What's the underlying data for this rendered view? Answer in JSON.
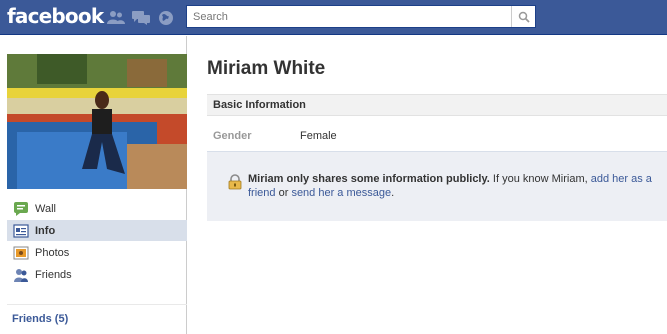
{
  "topbar": {
    "logo": "facebook",
    "jewels": [
      "friend-requests-icon",
      "messages-icon",
      "notifications-icon"
    ],
    "search_placeholder": "Search"
  },
  "profile": {
    "name": "Miriam White"
  },
  "nav": {
    "items": [
      {
        "label": "Wall",
        "icon": "wall-icon"
      },
      {
        "label": "Info",
        "icon": "info-icon",
        "active": true
      },
      {
        "label": "Photos",
        "icon": "photos-icon"
      },
      {
        "label": "Friends",
        "icon": "friends-icon"
      }
    ],
    "friends_link": "Friends (5)"
  },
  "basic_info": {
    "heading": "Basic Information",
    "rows": [
      {
        "label": "Gender",
        "value": "Female"
      }
    ]
  },
  "notice": {
    "bold": "Miriam only shares some information publicly.",
    "text1": " If you know Miriam, ",
    "link1": "add her as a friend",
    "text2": " or ",
    "link2": "send her a message",
    "text3": "."
  },
  "colors": {
    "brand": "#3b5998",
    "active_nav": "#d8dfea",
    "notice_bg": "#edeff4"
  }
}
